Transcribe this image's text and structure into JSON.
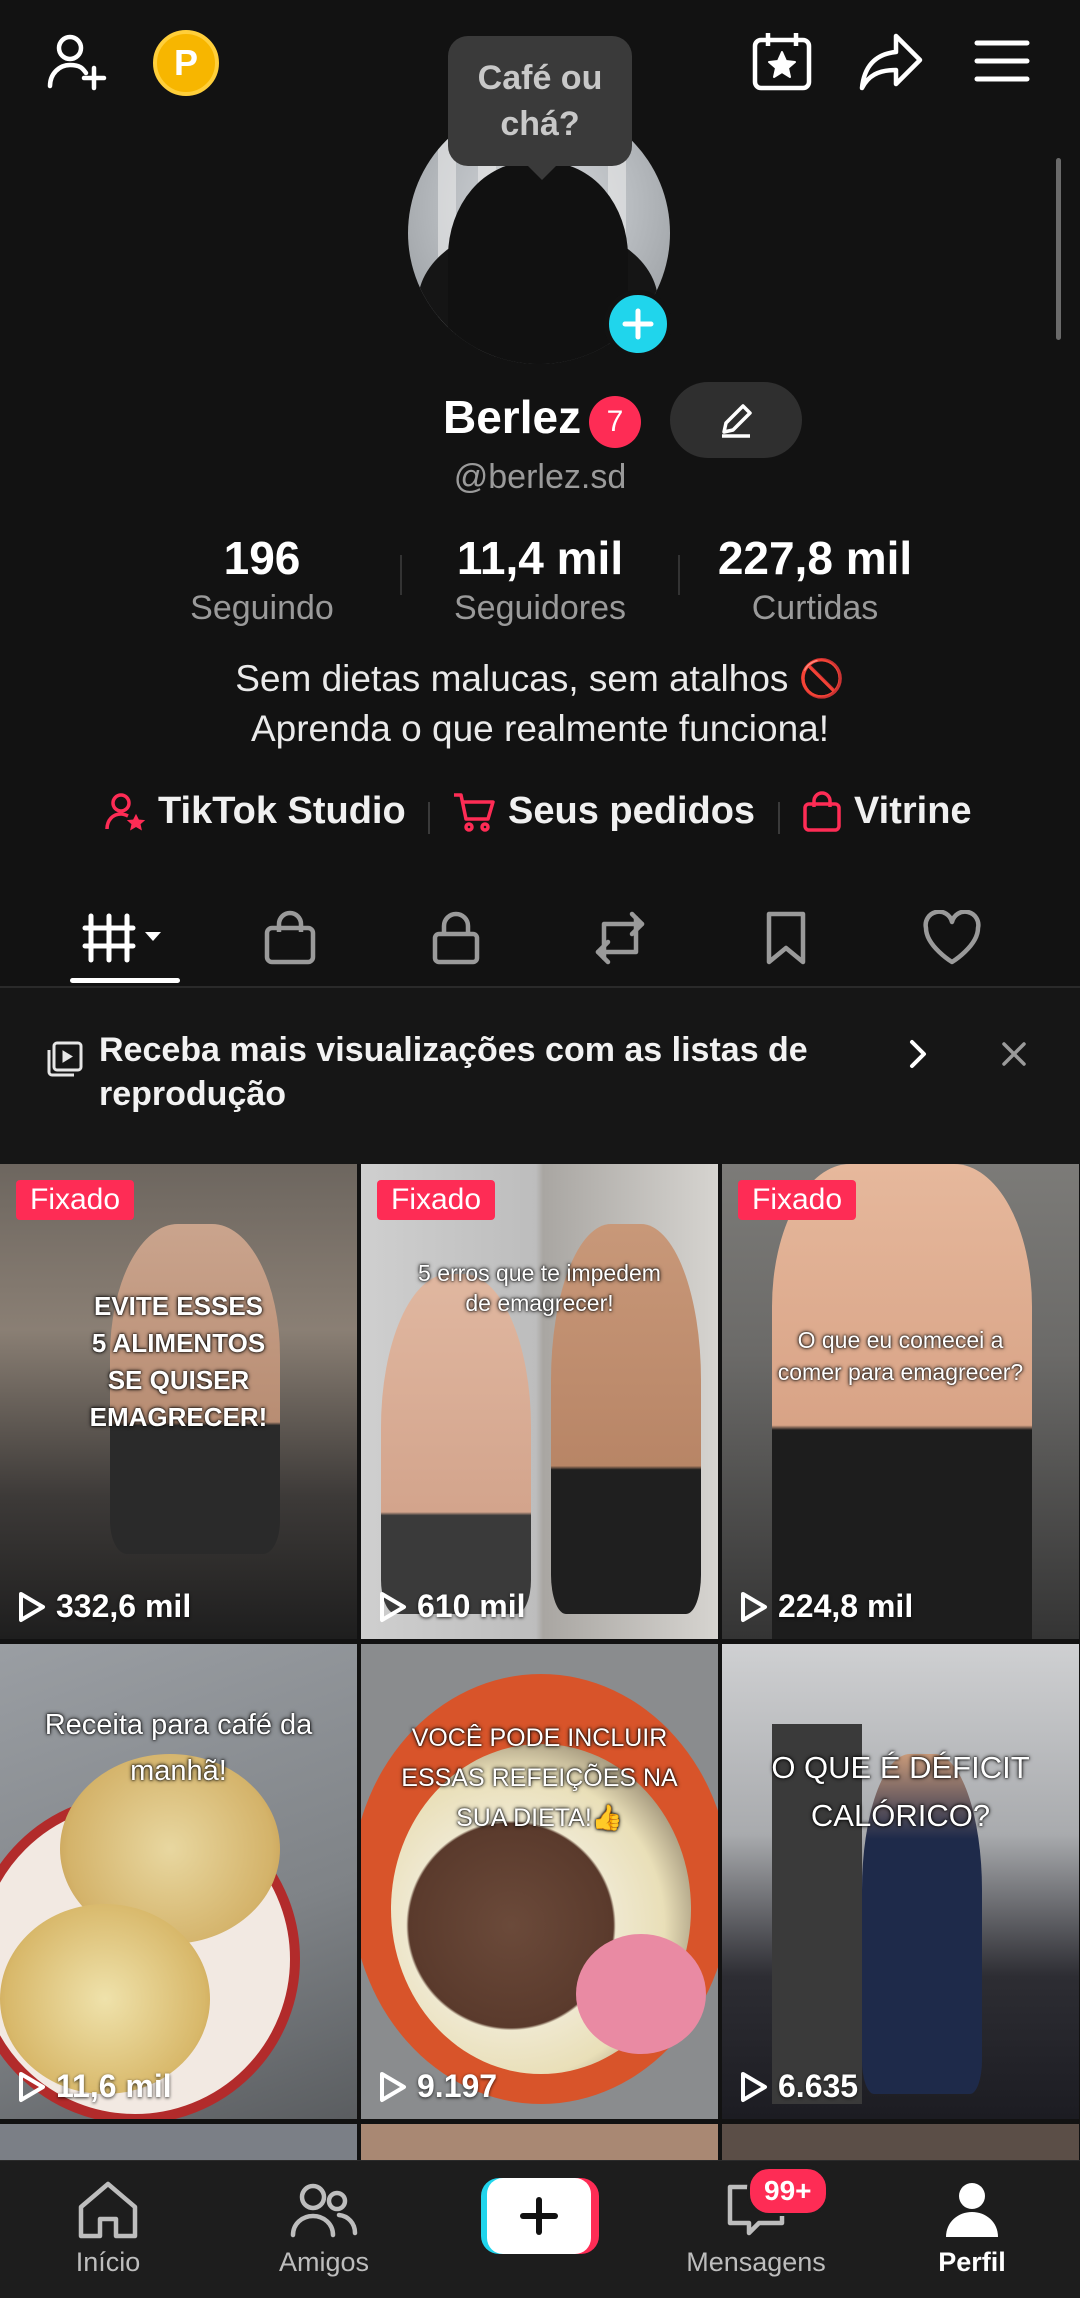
{
  "topbar": {
    "add_friend_icon": "person-plus-icon",
    "coins_label": "P",
    "calendar_icon": "calendar-star-icon",
    "share_icon": "share-arrow-icon",
    "menu_icon": "hamburger-menu-icon"
  },
  "profile": {
    "tooltip": "Café ou\nchá?",
    "name": "Berlez",
    "notification_count": "7",
    "handle": "@berlez.sd",
    "stats": [
      {
        "value": "196",
        "label": "Seguindo"
      },
      {
        "value": "11,4 mil",
        "label": "Seguidores"
      },
      {
        "value": "227,8 mil",
        "label": "Curtidas"
      }
    ],
    "bio_line1": "Sem dietas malucas, sem atalhos 🚫",
    "bio_line2": "Aprenda o que realmente funciona!"
  },
  "links": {
    "studio": "TikTok Studio",
    "orders": "Seus pedidos",
    "showcase": "Vitrine"
  },
  "tabs": [
    "videos-grid-icon",
    "shopping-bag-icon",
    "lock-icon",
    "repost-icon",
    "bookmark-icon",
    "heart-icon"
  ],
  "promo": {
    "text": "Receba mais visualizações com as listas de reprodução"
  },
  "videos": [
    {
      "pinned": "Fixado",
      "views": "332,6 mil",
      "caption": "EVITE ESSES\n5 ALIMENTOS\nSE QUISER\nEMAGRECER!"
    },
    {
      "pinned": "Fixado",
      "views": "610 mil",
      "caption": "5 erros que te impedem\nde emagrecer!"
    },
    {
      "pinned": "Fixado",
      "views": "224,8 mil",
      "caption": "O que eu comecei a\ncomer para emagrecer?"
    },
    {
      "pinned": "",
      "views": "11,6 mil",
      "caption": "Receita para café da\nmanhã!"
    },
    {
      "pinned": "",
      "views": "9.197",
      "caption": "VOCÊ PODE INCLUIR\nESSAS REFEIÇÕES NA\nSUA DIETA!👍"
    },
    {
      "pinned": "",
      "views": "6.635",
      "caption": "O QUE É DÉFICIT\nCALÓRICO?"
    }
  ],
  "bottom_nav": {
    "home": "Início",
    "friends": "Amigos",
    "messages": "Mensagens",
    "messages_badge": "99+",
    "profile": "Perfil"
  },
  "colors": {
    "accent": "#fe2c55",
    "cyan": "#20d5ec",
    "background": "#121212"
  }
}
